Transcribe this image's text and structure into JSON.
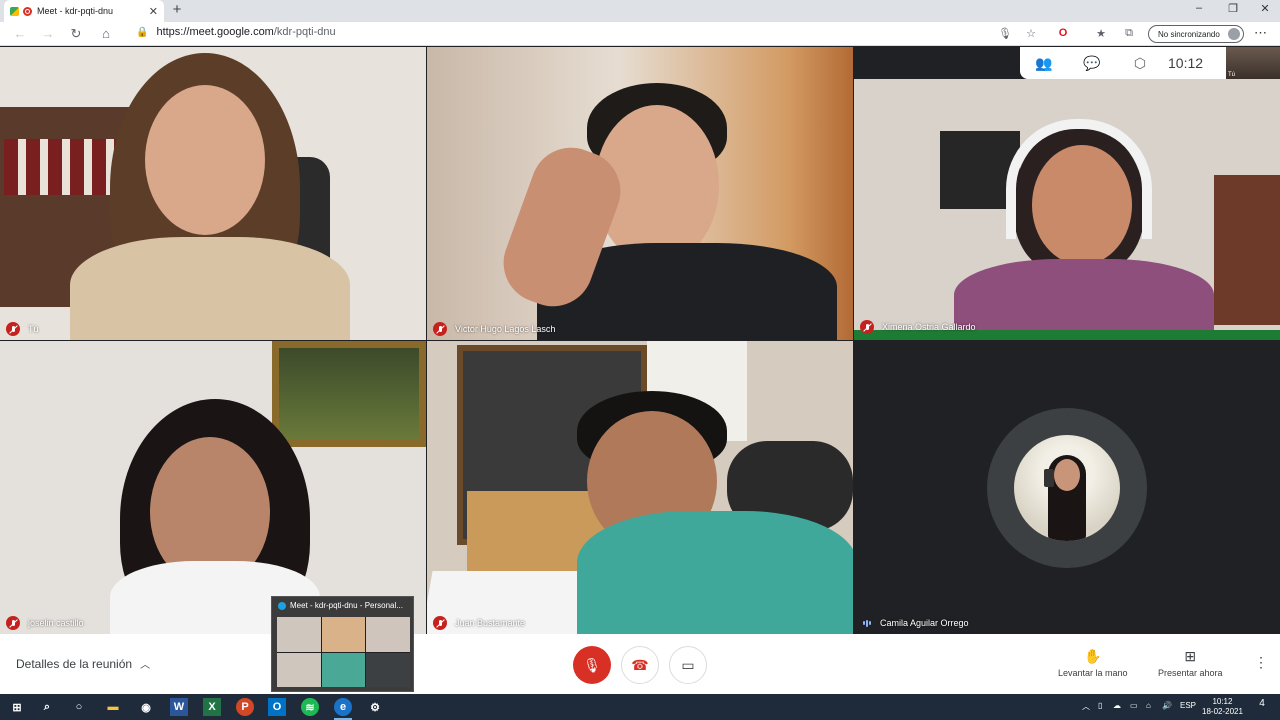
{
  "browser": {
    "tab_title": "Meet - kdr-pqti-dnu",
    "new_tab": "+",
    "url_host": "https://meet.google.com",
    "url_path": "/kdr-pqti-dnu",
    "sync_label": "No sincronizando"
  },
  "meet": {
    "clock": "10:12",
    "self_label": "Tú",
    "participants": [
      {
        "name": "Tú",
        "mic": "off"
      },
      {
        "name": "Victor Hugo Lagos Lasch",
        "mic": "off"
      },
      {
        "name": "Ximena Ostria Gallardo",
        "mic": "off"
      },
      {
        "name": "joselin castillo",
        "mic": "off"
      },
      {
        "name": "Juan Bustamante",
        "mic": "off"
      },
      {
        "name": "Camila Aguilar Orrego",
        "mic": "speaking"
      }
    ],
    "meeting_details": "Detalles de la reunión",
    "raise_hand": "Levantar la mano",
    "present_now": "Presentar ahora"
  },
  "preview": {
    "title": "Meet - kdr-pqti-dnu - Personal..."
  },
  "taskbar": {
    "language": "ESP",
    "time": "10:12",
    "date": "18-02-2021",
    "notification_count": "4"
  },
  "colors": {
    "accent_red": "#d93025",
    "speaking_blue": "#8ab4f8",
    "meet_background": "#202124"
  }
}
